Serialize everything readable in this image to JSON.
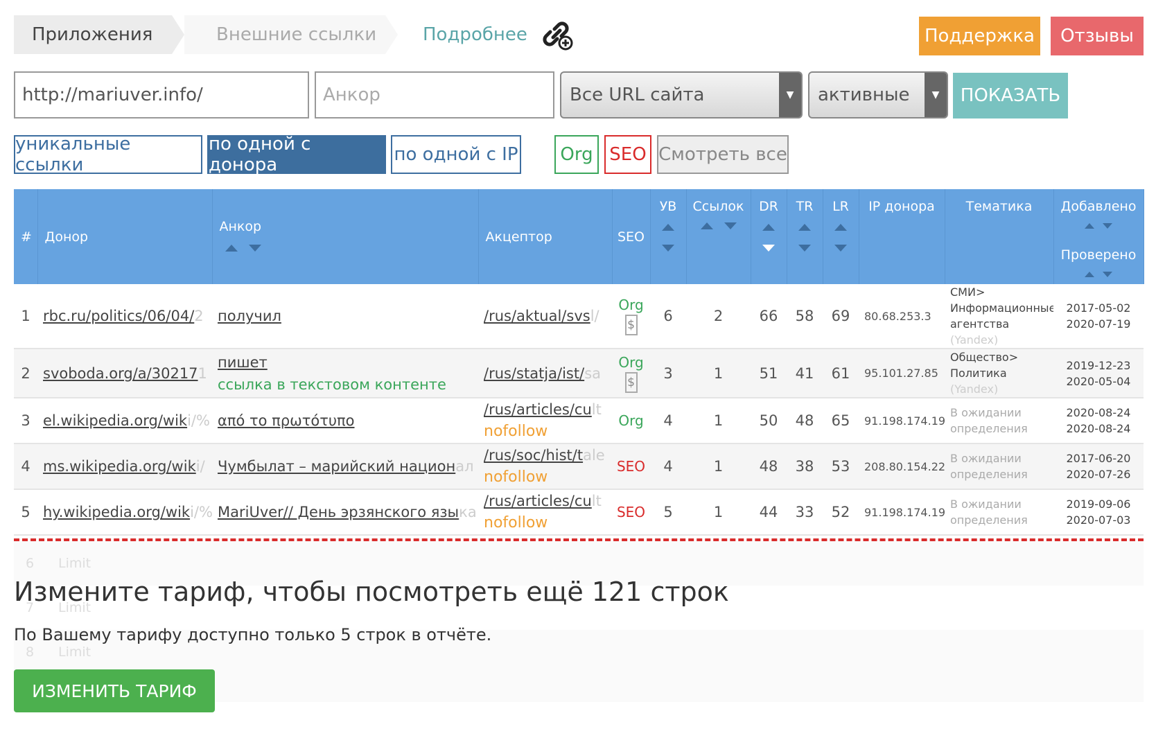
{
  "breadcrumb": {
    "apps": "Приложения",
    "external": "Внешние ссылки",
    "more": "Подробнее"
  },
  "header_buttons": {
    "support": "Поддержка",
    "reviews": "Отзывы"
  },
  "filters": {
    "url_value": "http://mariuver.info/",
    "anchor_placeholder": "Анкор",
    "url_select": "Все URL сайта",
    "status_select": "активные",
    "show": "ПОКАЗАТЬ"
  },
  "toggles": {
    "unique": "уникальные ссылки",
    "per_donor": "по одной с донора",
    "per_ip": "по одной с IP",
    "org": "Org",
    "seo": "SEO",
    "view_all": "Смотреть все"
  },
  "table": {
    "headers": {
      "num": "#",
      "donor": "Донор",
      "anchor": "Анкор",
      "acceptor": "Акцептор",
      "seo": "SEO",
      "uv": "УВ",
      "links": "Ссылок",
      "dr": "DR",
      "tr": "TR",
      "lr": "LR",
      "ip": "IP донора",
      "theme": "Тематика",
      "added": "Добавлено",
      "checked": "Проверено"
    },
    "rows": [
      {
        "n": "1",
        "donor": "rbc.ru/politics/06/04/",
        "donor_fade": "2",
        "anchor": "получил",
        "anchor_fade": "",
        "note": "",
        "acceptor": "/rus/aktual/svs",
        "acceptor_fade": "l/",
        "nofollow": "",
        "seo": "Org",
        "dollar": "$",
        "uv": "6",
        "links": "2",
        "dr": "66",
        "tr": "58",
        "lr": "69",
        "ip": "80.68.253.3",
        "theme1": "СМИ>",
        "theme2": "Информационные",
        "theme3": "агентства",
        "theme4": "(Yandex)",
        "added": "2017-05-02",
        "checked": "2020-07-19"
      },
      {
        "n": "2",
        "donor": "svoboda.org/a/30217",
        "donor_fade": "1",
        "anchor": "пишет",
        "anchor_fade": "",
        "note": "ссылка в текстовом контенте",
        "acceptor": "/rus/statja/ist/",
        "acceptor_fade": "sa",
        "nofollow": "",
        "seo": "Org",
        "dollar": "$",
        "uv": "3",
        "links": "1",
        "dr": "51",
        "tr": "41",
        "lr": "61",
        "ip": "95.101.27.85",
        "theme1": "Общество>",
        "theme2": "Политика",
        "theme3": "",
        "theme4": "(Yandex)",
        "added": "2019-12-23",
        "checked": "2020-05-04"
      },
      {
        "n": "3",
        "donor": "el.wikipedia.org/wik",
        "donor_fade": "i/%",
        "anchor": "από το πρωτότυπο",
        "anchor_fade": "",
        "note": "",
        "acceptor": "/rus/articles/cu",
        "acceptor_fade": "lt",
        "nofollow": "nofollow",
        "seo": "Org",
        "dollar": "",
        "uv": "4",
        "links": "1",
        "dr": "50",
        "tr": "48",
        "lr": "65",
        "ip": "91.198.174.192",
        "theme1": "В ожидании",
        "theme2": "определения",
        "theme3": "",
        "theme4": "",
        "added": "2020-08-24",
        "checked": "2020-08-24"
      },
      {
        "n": "4",
        "donor": "ms.wikipedia.org/wik",
        "donor_fade": "i/",
        "anchor": "Чумбылат – марийский национ",
        "anchor_fade": "ал",
        "note": "",
        "acceptor": "/rus/soc/hist/t",
        "acceptor_fade": "ale",
        "nofollow": "nofollow",
        "seo": "SEO",
        "dollar": "",
        "uv": "4",
        "links": "1",
        "dr": "48",
        "tr": "38",
        "lr": "53",
        "ip": "208.80.154.224",
        "theme1": "В ожидании",
        "theme2": "определения",
        "theme3": "",
        "theme4": "",
        "added": "2017-06-20",
        "checked": "2020-07-26"
      },
      {
        "n": "5",
        "donor": "hy.wikipedia.org/wik",
        "donor_fade": "i/%",
        "anchor": "MariUver// День эрзянского язы",
        "anchor_fade": "ка",
        "note": "",
        "acceptor": "/rus/articles/cu",
        "acceptor_fade": "lt",
        "nofollow": "nofollow",
        "seo": "SEO",
        "dollar": "",
        "uv": "5",
        "links": "1",
        "dr": "44",
        "tr": "33",
        "lr": "52",
        "ip": "91.198.174.192",
        "theme1": "В ожидании",
        "theme2": "определения",
        "theme3": "",
        "theme4": "",
        "added": "2019-09-06",
        "checked": "2020-07-03"
      }
    ]
  },
  "locked_rows": [
    {
      "n": "6",
      "label": "Limit"
    },
    {
      "n": "7",
      "label": "Limit"
    },
    {
      "n": "8",
      "label": "Limit"
    }
  ],
  "upsell": {
    "title": "Измените тариф, чтобы посмотреть ещё 121 строк",
    "text": "По Вашему тарифу доступно только 5 строк в отчёте.",
    "button": "ИЗМЕНИТЬ ТАРИФ"
  },
  "colors": {
    "header_blue": "#66a3e0",
    "support_orange": "#f0a034",
    "reviews_red": "#e8686c",
    "show_teal": "#79c2c0",
    "tariff_green": "#4cb04e",
    "org_green": "#3aa65a",
    "seo_red": "#d92b2b"
  }
}
